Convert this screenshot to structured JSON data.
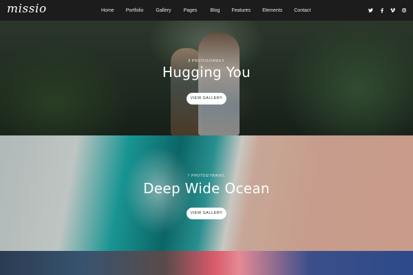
{
  "brand": {
    "logo_text": "missio"
  },
  "nav": {
    "items": [
      "Home",
      "Portfolio",
      "Gallery",
      "Pages",
      "Blog",
      "Features",
      "Elements",
      "Contact"
    ]
  },
  "socials": [
    "twitter-icon",
    "facebook-icon",
    "vimeo-icon",
    "instagram-icon"
  ],
  "galleries": [
    {
      "count": "8 Photos",
      "category": "Family",
      "title": "Hugging You",
      "button": "View Gallery"
    },
    {
      "count": "7 Photos",
      "category": "Travel",
      "title": "Deep Wide Ocean",
      "button": "View Gallery"
    }
  ],
  "separator": "/"
}
